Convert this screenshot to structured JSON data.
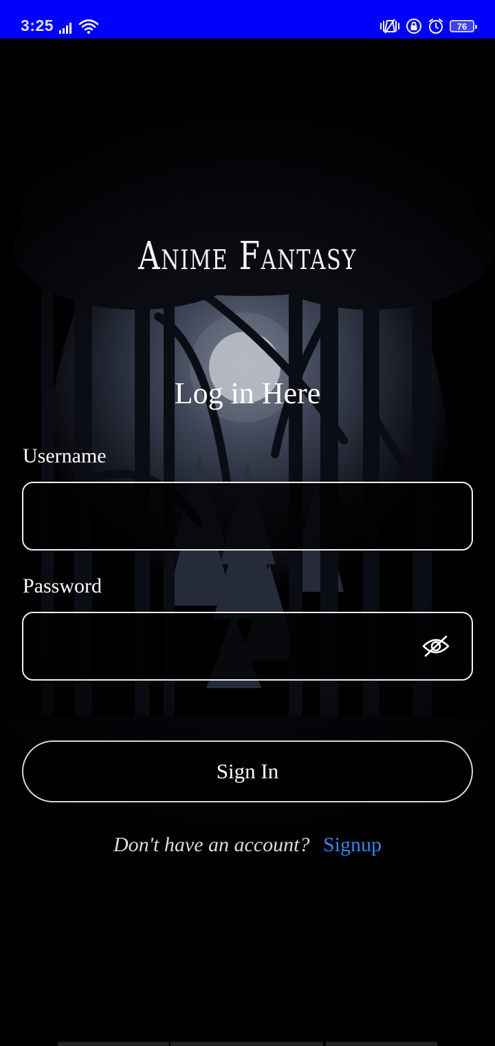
{
  "status_bar": {
    "time": "3:25",
    "battery_level": "76",
    "background_color": "#0000ff",
    "icons": [
      "signal-icon",
      "wifi-icon",
      "vibrate-icon",
      "lock-rotation-icon",
      "alarm-icon",
      "battery-icon"
    ]
  },
  "app": {
    "title": "Anime Fantasy"
  },
  "login": {
    "heading": "Log in Here",
    "username_label": "Username",
    "username_value": "",
    "password_label": "Password",
    "password_value": "",
    "password_visibility_icon": "eye-off-icon",
    "sign_in_label": "Sign In",
    "signup_prompt": "Don't have an account?",
    "signup_link": "Signup"
  },
  "colors": {
    "link": "#2f88f0",
    "text": "#ffffff",
    "background": "#000000"
  }
}
